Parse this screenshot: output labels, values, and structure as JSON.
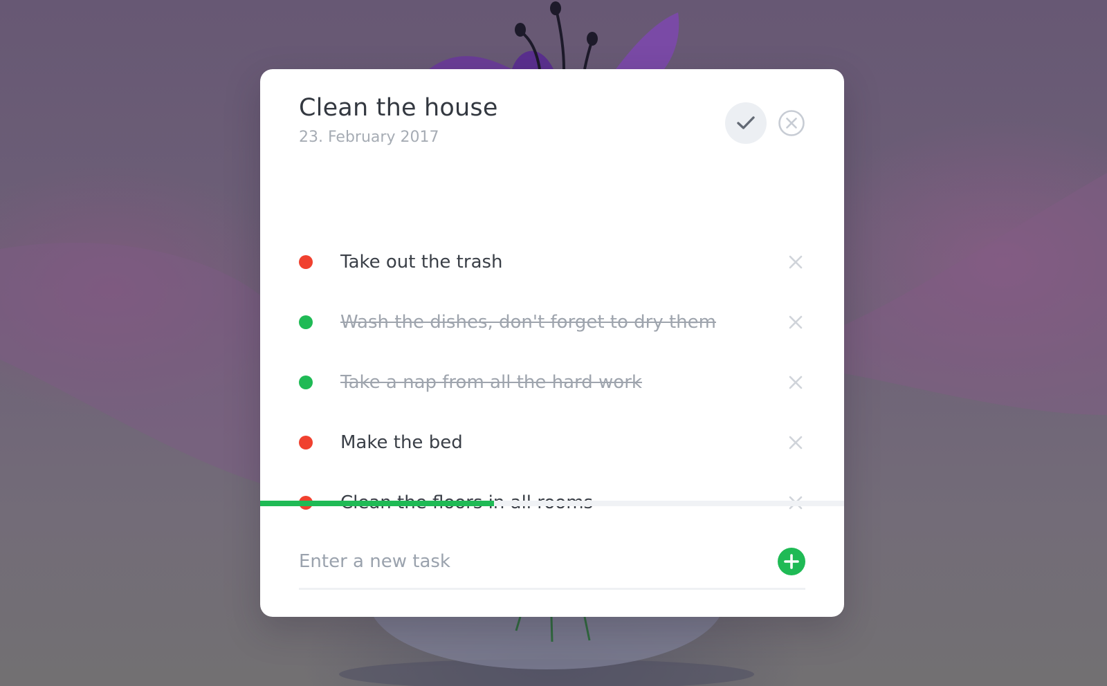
{
  "card": {
    "title": "Clean the house",
    "date": "23. February 2017"
  },
  "tasks": [
    {
      "text": "Take out the trash",
      "done": false
    },
    {
      "text": "Wash the dishes, don't forget to dry them",
      "done": true
    },
    {
      "text": "Take a nap from all the hard work",
      "done": true
    },
    {
      "text": "Make the bed",
      "done": false
    },
    {
      "text": "Clean the floors in all rooms",
      "done": false
    }
  ],
  "progress": {
    "fraction": 0.4
  },
  "new_task": {
    "placeholder": "Enter a new task",
    "value": ""
  },
  "icons": {
    "complete": "check-icon",
    "delete": "close-circle-icon",
    "remove": "close-icon",
    "add": "plus-icon"
  },
  "colors": {
    "pending": "#f0412f",
    "done": "#1fba55",
    "accent": "#1fba55",
    "progress_track": "#f0f2f5"
  }
}
